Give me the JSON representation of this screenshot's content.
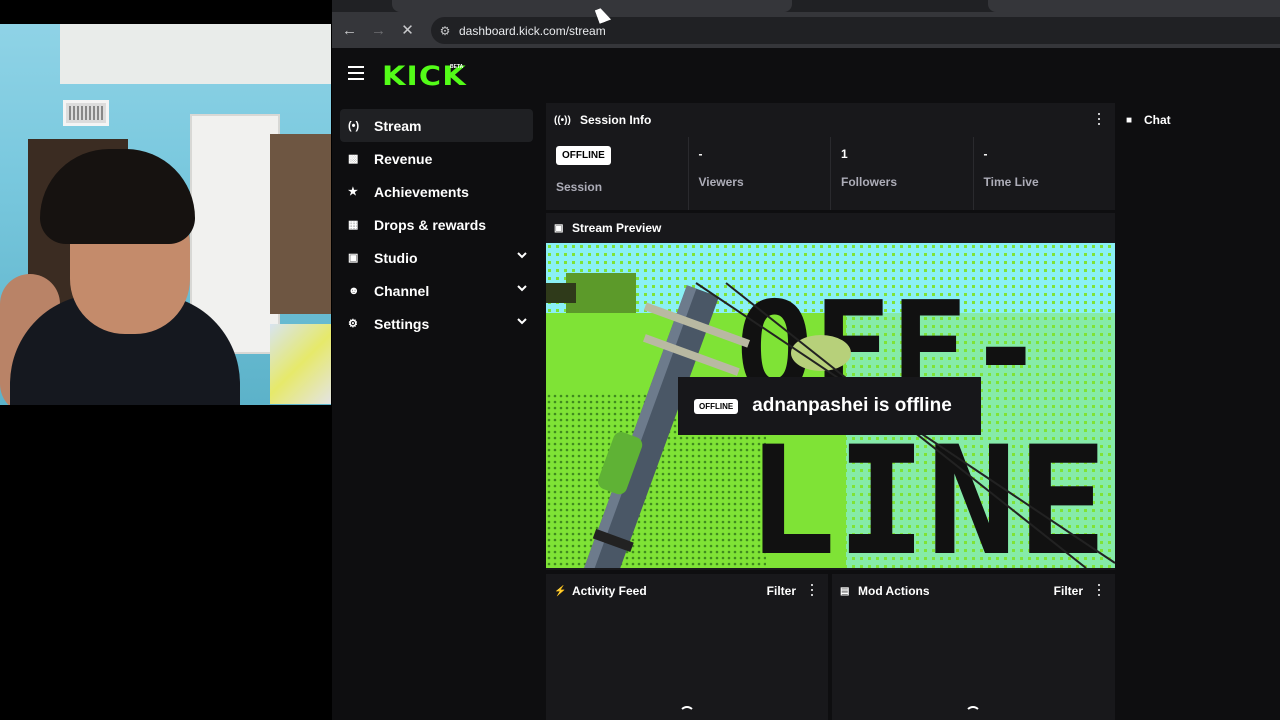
{
  "browser": {
    "url": "dashboard.kick.com/stream"
  },
  "app": {
    "logo": "KICK",
    "logo_badge": "BETA",
    "brand_color": "#53fc18"
  },
  "sidebar": {
    "items": [
      {
        "label": "Stream",
        "icon": "broadcast-icon",
        "active": true
      },
      {
        "label": "Revenue",
        "icon": "chart-icon"
      },
      {
        "label": "Achievements",
        "icon": "trophy-icon"
      },
      {
        "label": "Drops & rewards",
        "icon": "gift-icon"
      },
      {
        "label": "Studio",
        "icon": "studio-icon",
        "expandable": true
      },
      {
        "label": "Channel",
        "icon": "user-icon",
        "expandable": true
      },
      {
        "label": "Settings",
        "icon": "gear-icon",
        "expandable": true
      }
    ]
  },
  "session_info": {
    "title": "Session Info",
    "status_badge": "OFFLINE",
    "stats": [
      {
        "label": "Session",
        "value": ""
      },
      {
        "label": "Viewers",
        "value": "-"
      },
      {
        "label": "Followers",
        "value": "1"
      },
      {
        "label": "Time Live",
        "value": "-"
      }
    ]
  },
  "stream_preview": {
    "title": "Stream Preview",
    "badge": "OFFLINE",
    "message": "adnanpashei is offline"
  },
  "activity_feed": {
    "title": "Activity Feed",
    "filter_label": "Filter"
  },
  "mod_actions": {
    "title": "Mod Actions",
    "filter_label": "Filter"
  },
  "chat": {
    "title": "Chat"
  }
}
